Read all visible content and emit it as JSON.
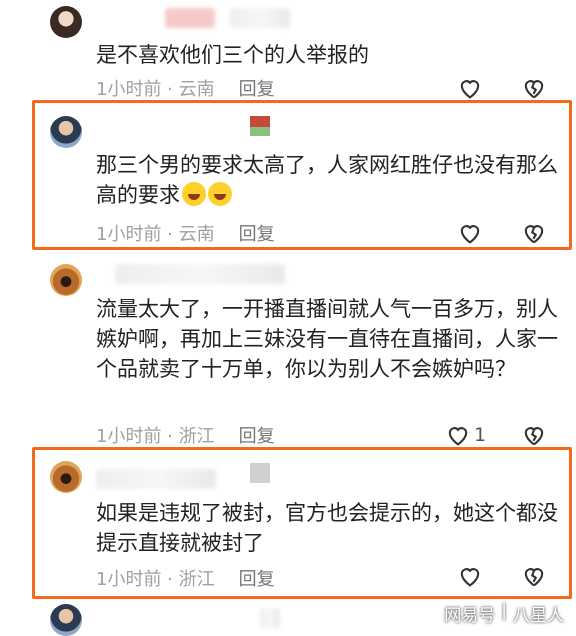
{
  "comments": [
    {
      "text": "是不喜欢他们三个的人举报的",
      "time": "1小时前",
      "location": "云南",
      "reply_label": "回复",
      "likes": ""
    },
    {
      "text": "那三个男的要求太高了，人家网红胜仔也没有那么高的要求",
      "emoji": [
        "laughing-crying",
        "laughing-crying"
      ],
      "time": "1小时前",
      "location": "云南",
      "reply_label": "回复",
      "likes": ""
    },
    {
      "text": "流量太大了，一开播直播间就人气一百多万，别人嫉妒啊，再加上三妹没有一直待在直播间，人家一个品就卖了十万单，你以为别人不会嫉妒吗？",
      "time": "1小时前",
      "location": "浙江",
      "reply_label": "回复",
      "likes": "1"
    },
    {
      "text": "如果是违规了被封，官方也会提示的，她这个都没提示直接就被封了",
      "time": "1小时前",
      "location": "浙江",
      "reply_label": "回复",
      "likes": ""
    }
  ],
  "watermark": {
    "brand": "网易号",
    "separator": "|",
    "author": "八星人"
  },
  "colors": {
    "highlight_border": "#f26a1b",
    "meta_text": "#a0a0a0"
  }
}
